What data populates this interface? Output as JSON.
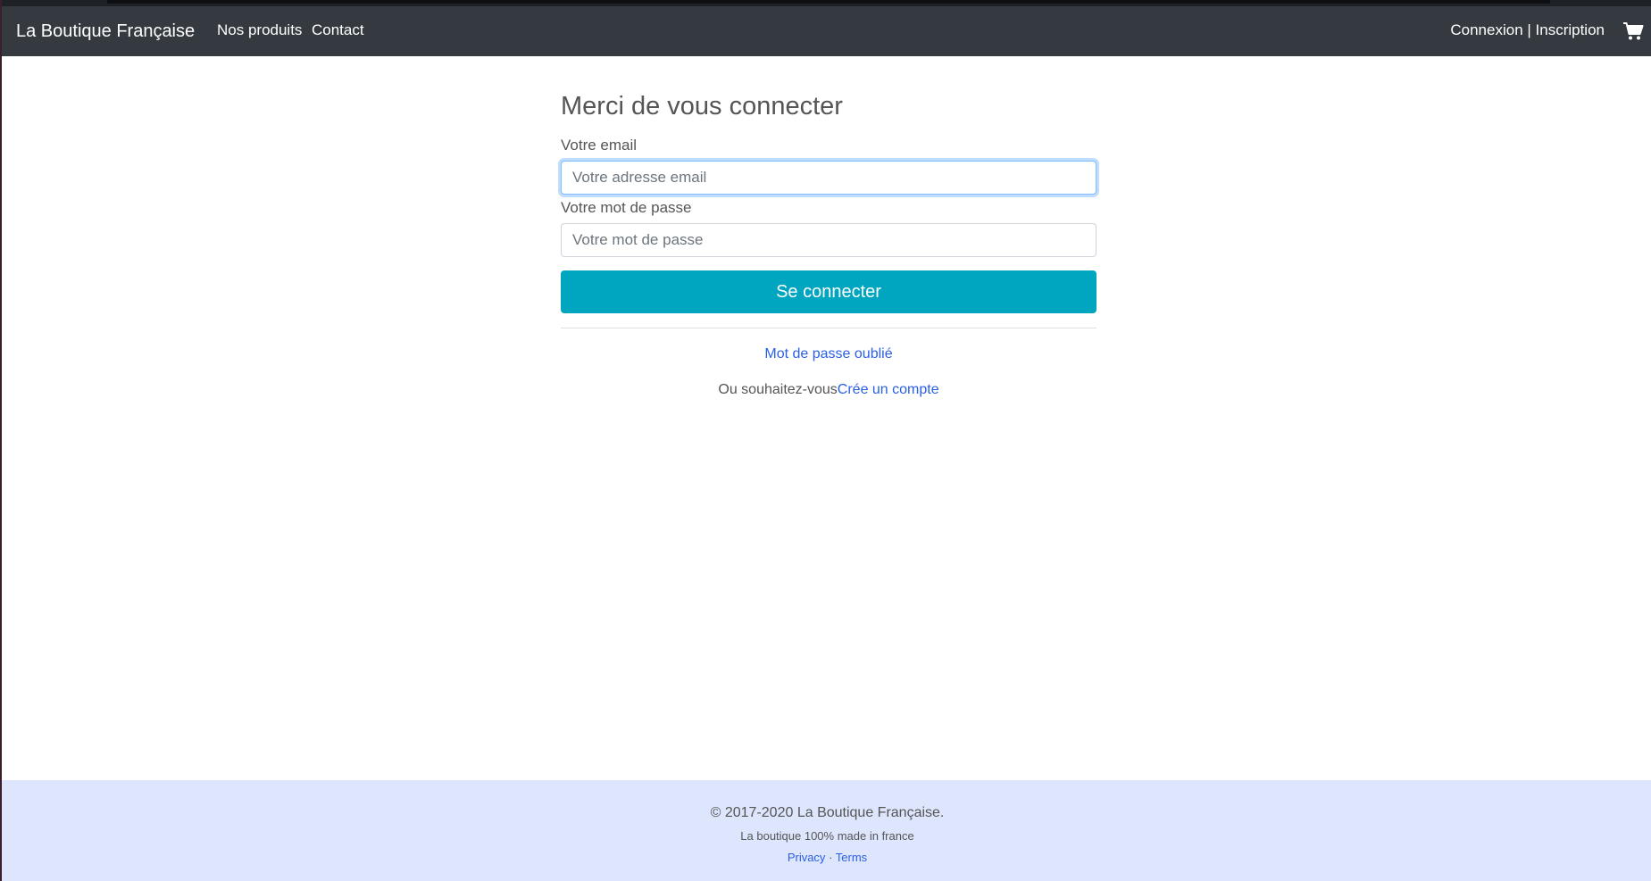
{
  "navbar": {
    "brand": "La Boutique Française",
    "links": [
      "Nos produits",
      "Contact"
    ],
    "auth": "Connexion | Inscription",
    "cart_icon": "shopping-cart-icon",
    "background": "#343a40"
  },
  "login_form": {
    "title": "Merci de vous connecter",
    "email_label": "Votre email",
    "email_placeholder": "Votre adresse email",
    "password_label": "Votre mot de passe",
    "password_placeholder": "Votre mot de passe",
    "submit_label": "Se connecter",
    "submit_color": "#00a5bf",
    "forgot_link": "Mot de passe oublié",
    "signup_prefix": "Ou souhaitez-vous",
    "signup_link": "Crée un compte"
  },
  "footer": {
    "copyright": "© 2017-2020 La Boutique Française.",
    "tagline": "La boutique 100% made in france",
    "privacy": "Privacy",
    "separator": "·",
    "terms": "Terms",
    "background": "#dde6fd"
  }
}
